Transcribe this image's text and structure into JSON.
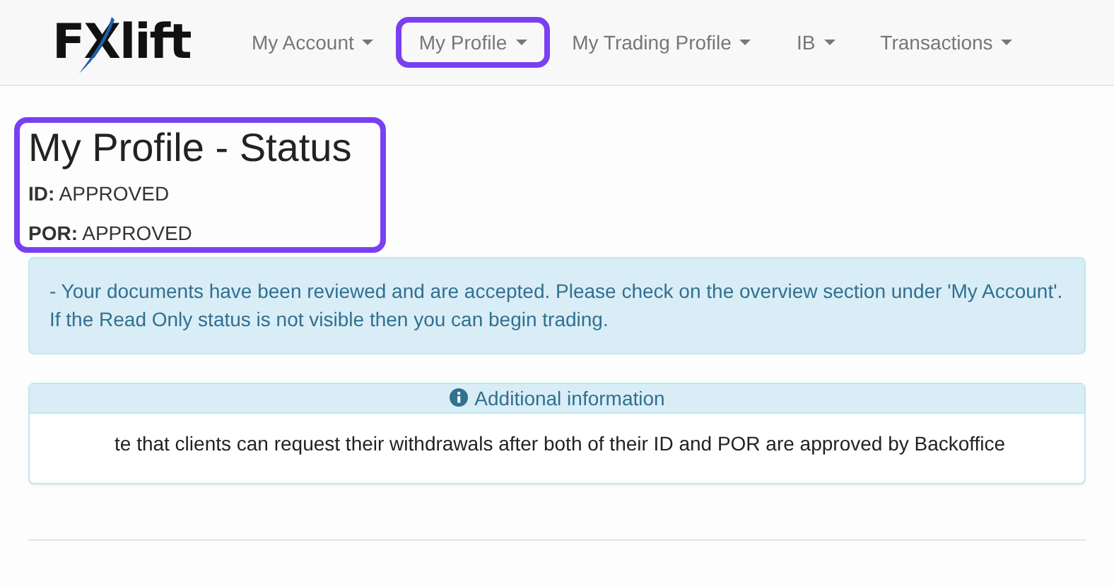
{
  "logo": "FXlift",
  "nav": [
    {
      "label": "My Account",
      "highlighted": false
    },
    {
      "label": "My Profile",
      "highlighted": true
    },
    {
      "label": "My Trading Profile",
      "highlighted": false
    },
    {
      "label": "IB",
      "highlighted": false
    },
    {
      "label": "Transactions",
      "highlighted": false
    }
  ],
  "status": {
    "title": "My Profile - Status",
    "highlighted": true,
    "items": [
      {
        "label": "ID:",
        "value": "APPROVED"
      },
      {
        "label": "POR:",
        "value": "APPROVED"
      }
    ]
  },
  "alert": {
    "lines": [
      "- Your documents have been reviewed and are accepted. Please check on the overview section under 'My Account'.",
      "If the Read Only status is not visible then you can begin trading."
    ]
  },
  "panel": {
    "heading": "Additional information",
    "body": "te that clients can request their withdrawals after both of their ID and POR are approved by Backoffice"
  }
}
